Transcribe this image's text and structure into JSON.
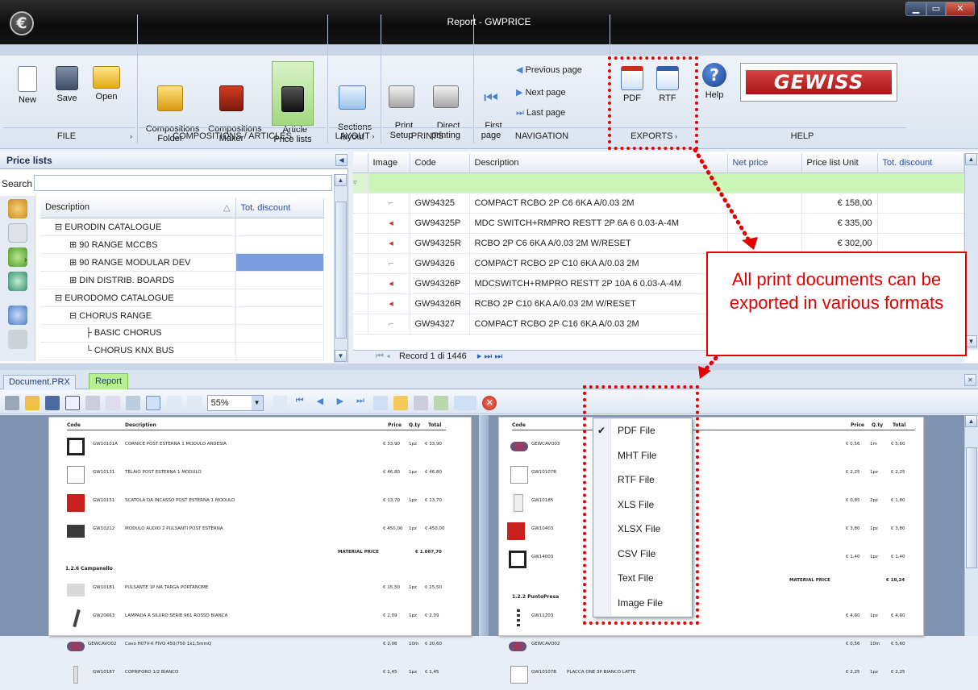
{
  "window": {
    "title": "Report - GWPRICE",
    "logo_glyph": "€"
  },
  "ribbon": {
    "buttons": [
      {
        "label": "New"
      },
      {
        "label": "Save"
      },
      {
        "label": "Open"
      },
      {
        "label": "Compositions\nFolder"
      },
      {
        "label": "Compositions\nMaker"
      },
      {
        "label": "Article\nPrice lists"
      },
      {
        "label": "Sections\nlayout"
      },
      {
        "label": "Print\nSetup"
      },
      {
        "label": "Direct\nprinting"
      },
      {
        "label": "First\npage"
      },
      {
        "label": "PDF"
      },
      {
        "label": "RTF"
      },
      {
        "label": "Help"
      }
    ],
    "nav": {
      "previous": "Previous page",
      "next": "Next page",
      "last": "Last page"
    },
    "groups": [
      "FILE",
      "COMPOSITIONS / ARTICLES",
      "LAYOUT",
      "PRINTS",
      "NAVIGATION",
      "EXPORTS",
      "HELP"
    ],
    "brand": "GEWISS"
  },
  "price_lists": {
    "title": "Price lists",
    "search_label": "Search",
    "search_value": "",
    "col_description": "Description",
    "col_discount": "Tot. discount",
    "items": [
      {
        "label": "EURODIN CATALOGUE",
        "prefix": "⊟"
      },
      {
        "label": "90 RANGE MCCBS",
        "prefix": "⊞"
      },
      {
        "label": "90 RANGE MODULAR DEV",
        "prefix": "⊞"
      },
      {
        "label": "DIN DISTRIB. BOARDS",
        "prefix": "⊞"
      },
      {
        "label": "EURODOMO CATALOGUE",
        "prefix": "⊟"
      },
      {
        "label": "CHORUS RANGE",
        "prefix": "⊟"
      },
      {
        "label": "BASIC CHORUS",
        "prefix": "├"
      },
      {
        "label": "CHORUS KNX BUS",
        "prefix": "└"
      }
    ]
  },
  "articles": {
    "columns": [
      "Image",
      "Code",
      "Description",
      "Net price",
      "Price list Unit",
      "Tot. discount"
    ],
    "rows": [
      {
        "code": "GW94325",
        "description": "COMPACT RCBO 2P C6 6KA A/0.03 2M",
        "unit": "€ 158,00"
      },
      {
        "code": "GW94325P",
        "description": "MDC SWITCH+RMPRO RESTT 2P 6A 6 0.03-A-4M",
        "unit": "€ 335,00"
      },
      {
        "code": "GW94325R",
        "description": "RCBO 2P C6 6KA A/0.03 2M W/RESET",
        "unit": "€ 302,00"
      },
      {
        "code": "GW94326",
        "description": "COMPACT RCBO 2P C10 6KA A/0.03 2M",
        "unit": ""
      },
      {
        "code": "GW94326P",
        "description": "MDCSWITCH+RMPRO RESTT 2P 10A 6 0.03-A-4M",
        "unit": ""
      },
      {
        "code": "GW94326R",
        "description": "RCBO 2P C10 6KA A/0.03 2M W/RESET",
        "unit": ""
      },
      {
        "code": "GW94327",
        "description": "COMPACT RCBO 2P C16 6KA A/0.03 2M",
        "unit": ""
      }
    ],
    "record_nav": "Record 1 di 1446"
  },
  "tabs": {
    "doc": "Document.PRX",
    "report": "Report"
  },
  "report_toolbar": {
    "zoom": "55%"
  },
  "preview_left": {
    "header": {
      "code": "Code",
      "desc": "Description",
      "price": "Price",
      "qty": "Q.ty",
      "total": "Total"
    },
    "rows": [
      {
        "code": "GW10101A",
        "desc": "CORNICE POST ESTERNA 1 MODULO ARDESIA",
        "price": "€ 33,90",
        "qty": "1pz",
        "total": "€ 33,90"
      },
      {
        "code": "GW10131",
        "desc": "TELAIO POST ESTERNA 1 MODULO",
        "price": "€ 46,80",
        "qty": "1pz",
        "total": "€ 46,80"
      },
      {
        "code": "GW10151",
        "desc": "SCATOLA DA INCASSO POST ESTERNA 1 MODULO",
        "price": "€ 13,70",
        "qty": "1pz",
        "total": "€ 13,70"
      },
      {
        "code": "GW10212",
        "desc": "MODULO AUDIO 2 PULSANTI POST ESTERNA",
        "price": "€ 450,00",
        "qty": "1pz",
        "total": "€ 450,00"
      }
    ],
    "material_label": "MATERIAL PRICE",
    "material_total": "€ 1.067,70",
    "section": "1.2.6 Campanello",
    "rows2": [
      {
        "code": "GW10181",
        "desc": "PULSANTE 1P NA TARGA PORTANOME",
        "price": "€ 15,50",
        "qty": "1pz",
        "total": "€ 15,50"
      },
      {
        "code": "GW20663",
        "desc": "LAMPADA A SILURO SERIE 961 ROSSO BIANCA",
        "price": "€ 2,09",
        "qty": "1pz",
        "total": "€ 2,09"
      },
      {
        "code": "GEWCAVO02",
        "desc": "Cavo H07V-K FIVO 450/750 1x1,5mmQ",
        "price": "€ 2,06",
        "qty": "10m",
        "total": "€ 20,60"
      },
      {
        "code": "GW10187",
        "desc": "COPRIFORO 1/2 BIANCO",
        "price": "€ 1,45",
        "qty": "1pz",
        "total": "€ 1,45"
      }
    ]
  },
  "preview_right": {
    "header": {
      "code": "Code",
      "price": "Price",
      "qty": "Q.ty",
      "total": "Total"
    },
    "rows": [
      {
        "code": "GEWCAVO03",
        "price": "€ 0,56",
        "qty": "1m",
        "total": "€ 5,60"
      },
      {
        "code": "GW10107B",
        "price": "€ 2,25",
        "qty": "1pz",
        "total": "€ 2,25"
      },
      {
        "code": "GW10185",
        "price": "€ 0,85",
        "qty": "2pz",
        "total": "€ 1,80"
      },
      {
        "code": "GW10403",
        "price": "€ 3,80",
        "qty": "1pz",
        "total": "€ 3,80"
      },
      {
        "code": "GW14003",
        "price": "€ 1,40",
        "qty": "1pz",
        "total": "€ 1,40"
      }
    ],
    "material_label": "MATERIAL PRICE",
    "material_total": "€ 18,24",
    "section": "1.2.2 PuntoPresa",
    "rows2": [
      {
        "code": "GW11203",
        "price": "€ 4,60",
        "qty": "1pz",
        "total": "€ 4,60"
      },
      {
        "code": "GEWCAVO02",
        "price": "€ 0,56",
        "qty": "10m",
        "total": "€ 5,60"
      },
      {
        "code": "GW10107B",
        "desc": "PLACCA ONE 3P BIANCO LATTE",
        "price": "€ 2,25",
        "qty": "1pz",
        "total": "€ 2,25"
      }
    ]
  },
  "export_menu": {
    "items": [
      "PDF File",
      "MHT File",
      "RTF File",
      "XLS File",
      "XLSX File",
      "CSV File",
      "Text File",
      "Image File"
    ],
    "checked": "PDF File"
  },
  "callout": {
    "text": "All print documents can be exported in various formats"
  }
}
